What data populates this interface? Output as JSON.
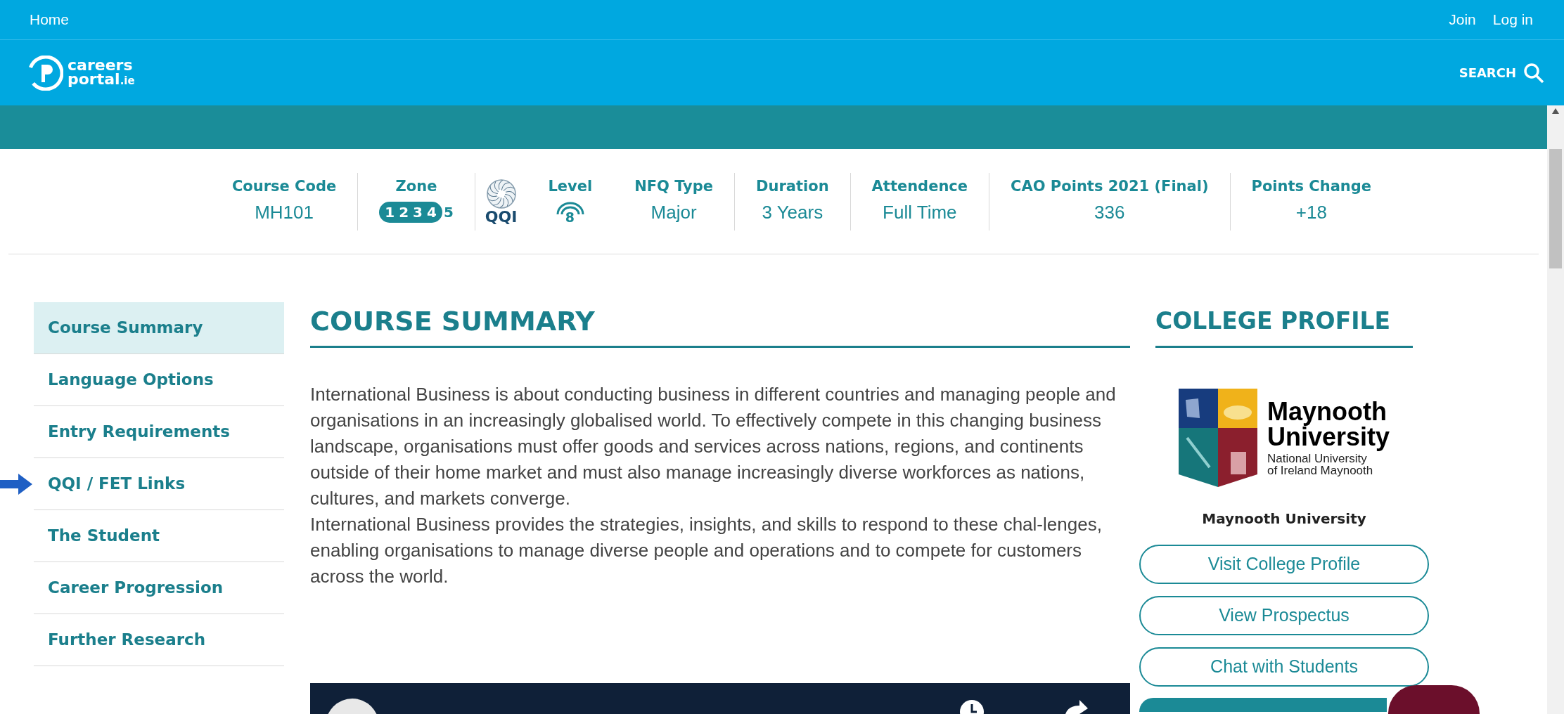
{
  "top_bar": {
    "home": "Home",
    "links": [
      "Join",
      "Log in"
    ]
  },
  "header": {
    "logo_line_1": "careers",
    "logo_line_2": "portal",
    "logo_suffix": ".ie",
    "search": "SEARCH"
  },
  "course_info": [
    {
      "kind": "text",
      "label": "Course Code",
      "value": "MH101"
    },
    {
      "kind": "zones",
      "label": "Zone",
      "zones": [
        {
          "label": "1",
          "selected": true
        },
        {
          "label": "2",
          "selected": true
        },
        {
          "label": "3",
          "selected": true
        },
        {
          "label": "4",
          "selected": true
        },
        {
          "label": "5",
          "selected": false
        }
      ]
    },
    {
      "kind": "qqi",
      "label": "QQI"
    },
    {
      "kind": "level",
      "label": "Level",
      "value": "8"
    },
    {
      "kind": "text",
      "label": "NFQ Type",
      "value": "Major"
    },
    {
      "kind": "text",
      "label": "Duration",
      "value": "3 Years"
    },
    {
      "kind": "text",
      "label": "Attendence",
      "value": "Full Time"
    },
    {
      "kind": "text",
      "label": "CAO Points 2021 (Final)",
      "value": "336"
    },
    {
      "kind": "text",
      "label": "Points Change",
      "value": "+18"
    }
  ],
  "sidebar": {
    "items": [
      {
        "label": "Course Summary",
        "selected": true,
        "pointed": false
      },
      {
        "label": "Language Options",
        "selected": false,
        "pointed": false
      },
      {
        "label": "Entry Requirements",
        "selected": false,
        "pointed": false
      },
      {
        "label": "QQI / FET Links",
        "selected": false,
        "pointed": true
      },
      {
        "label": "The Student",
        "selected": false,
        "pointed": false
      },
      {
        "label": "Career Progression",
        "selected": false,
        "pointed": false
      },
      {
        "label": "Further Research",
        "selected": false,
        "pointed": false
      }
    ]
  },
  "main": {
    "title": "COURSE SUMMARY",
    "paragraphs": [
      "International Business is about conducting business in different countries and managing people and organisations in an increasingly globalised world. To effectively compete in this changing business landscape, organisations must offer goods and services across nations, regions, and continents outside of their home market and must also manage increasingly diverse workforces as nations, cultures, and markets converge.",
      "International Business provides the strategies, insights, and skills to respond to these chal-lenges, enabling organisations to manage diverse people and operations and to compete for customers across the world."
    ]
  },
  "college_profile": {
    "title": "COLLEGE PROFILE",
    "logo_lines": [
      "Maynooth",
      "University",
      "National University",
      "of Ireland Maynooth"
    ],
    "name": "Maynooth University",
    "buttons": [
      "Visit College Profile",
      "View Prospectus",
      "Chat with Students"
    ]
  }
}
